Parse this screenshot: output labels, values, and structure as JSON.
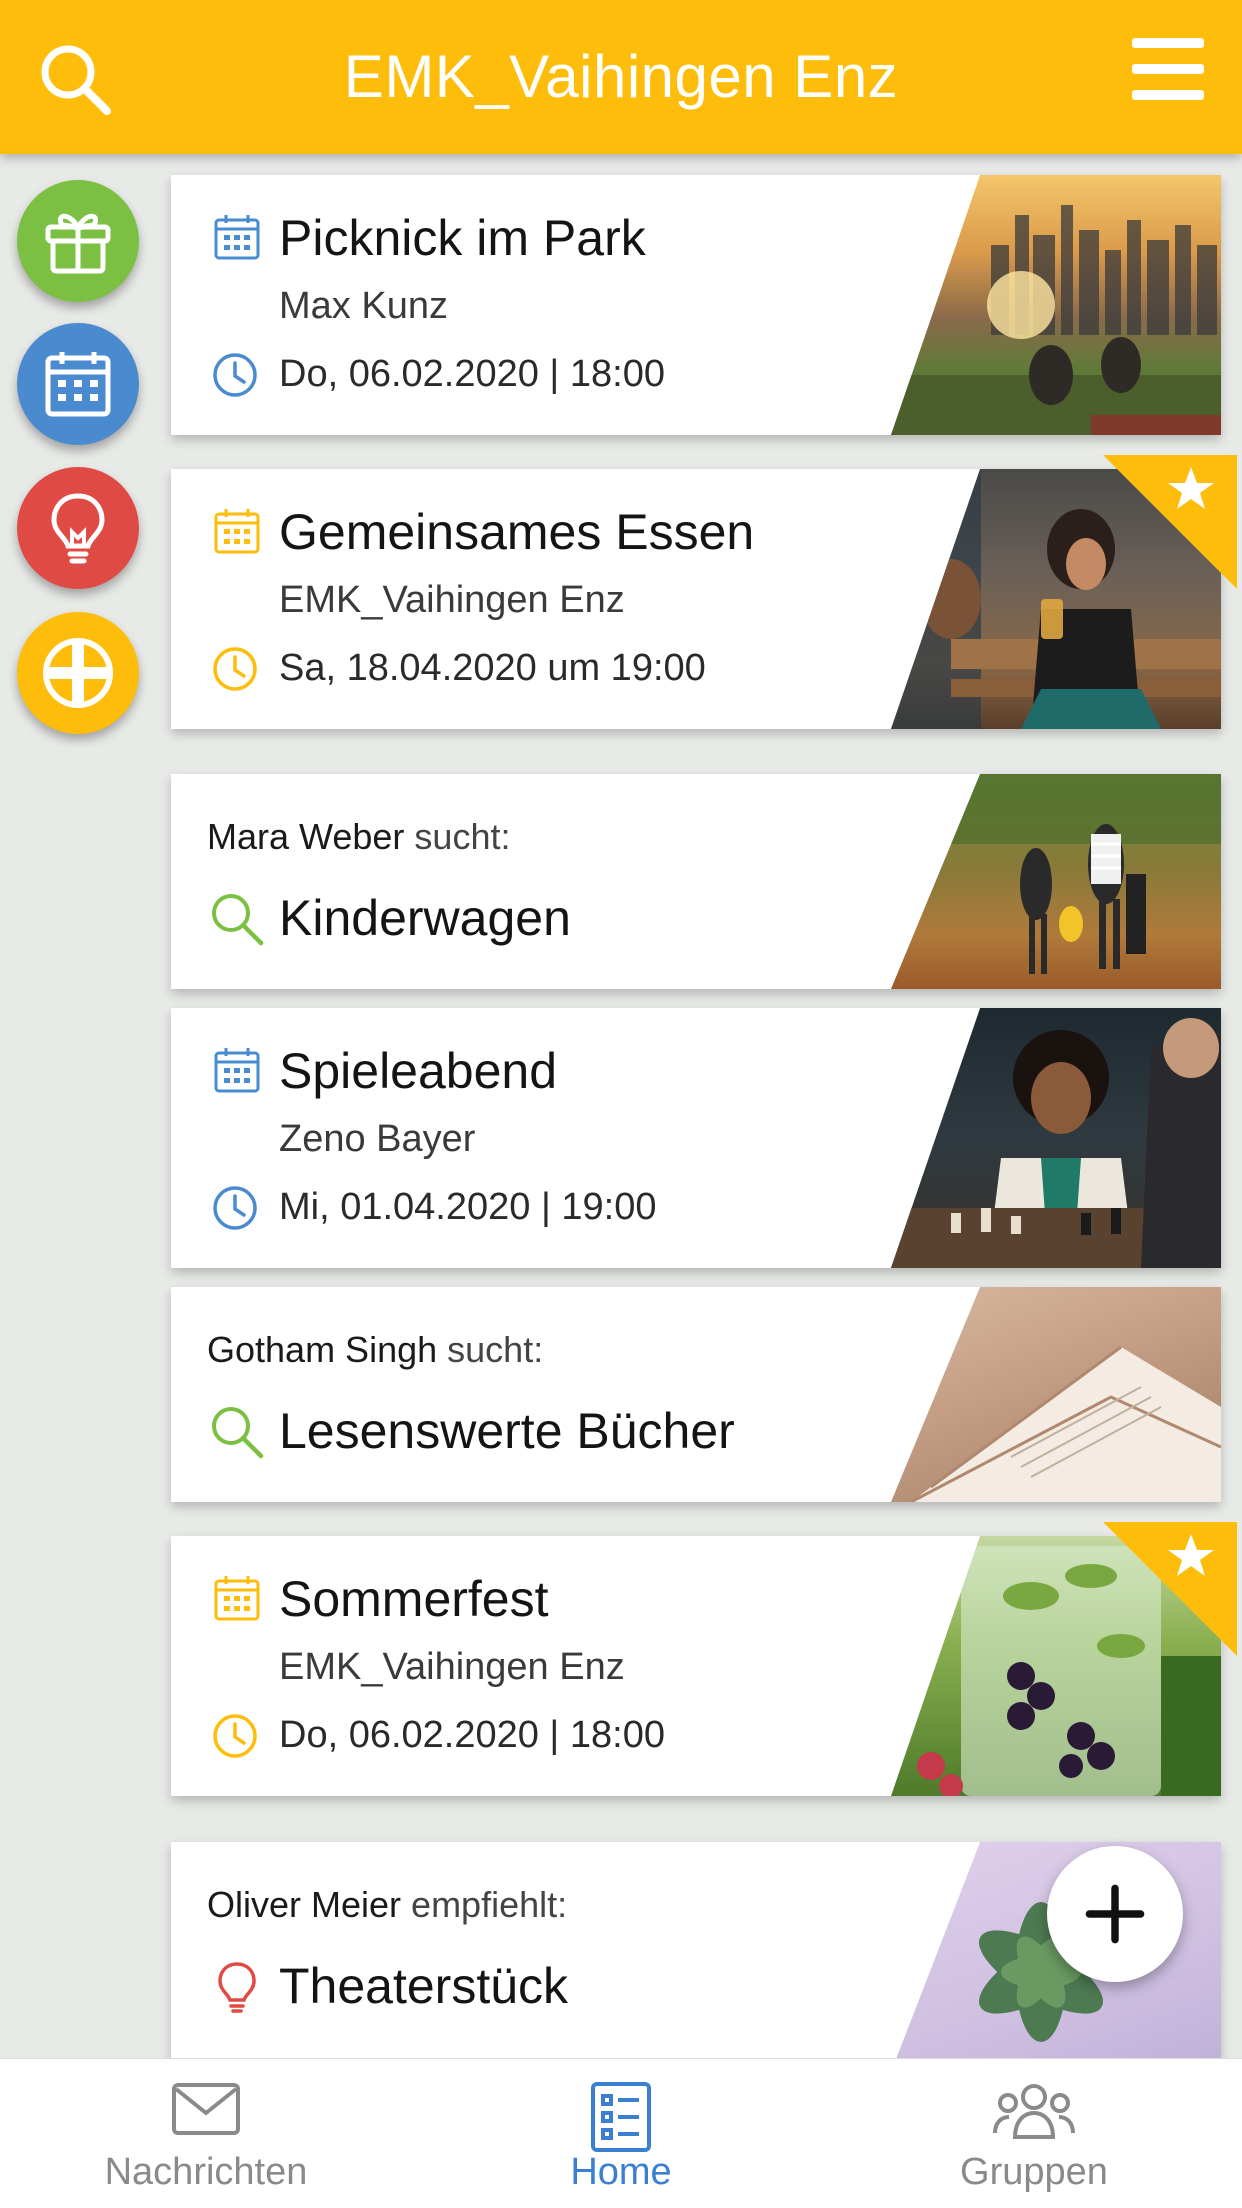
{
  "header": {
    "title": "EMK_Vaihingen Enz"
  },
  "icons": {
    "search": "search-icon",
    "menu": "menu-icon",
    "gift": "gift-icon",
    "calendar": "calendar-icon",
    "idea": "lightbulb-icon",
    "church": "cross-icon"
  },
  "colors": {
    "brand": "#fdbd0a",
    "green": "#7bc043",
    "blue": "#4a8bd0",
    "red": "#e04a44",
    "yellow": "#fdbd0a",
    "nav_active": "#3b7fd0",
    "nav_inactive": "#8a8a8a"
  },
  "cards": [
    {
      "type": "event",
      "title": "Picknick im Park",
      "subtitle": "Max Kunz",
      "datetime": "Do, 06.02.2020 | 18:00",
      "accent": "blue",
      "featured": false
    },
    {
      "type": "event",
      "title": "Gemeinsames Essen",
      "subtitle": "EMK_Vaihingen Enz",
      "datetime": "Sa, 18.04.2020 um 19:00",
      "accent": "yellow",
      "featured": true
    },
    {
      "type": "search",
      "person": "Mara Weber",
      "verb": "sucht:",
      "title": "Kinderwagen"
    },
    {
      "type": "event",
      "title": "Spieleabend",
      "subtitle": "Zeno Bayer",
      "datetime": "Mi, 01.04.2020 | 19:00",
      "accent": "blue",
      "featured": false
    },
    {
      "type": "search",
      "person": "Gotham Singh",
      "verb": "sucht:",
      "title": "Lesenswerte Bücher"
    },
    {
      "type": "event",
      "title": "Sommerfest",
      "subtitle": "EMK_Vaihingen Enz",
      "datetime": "Do, 06.02.2020 | 18:00",
      "accent": "yellow",
      "featured": true
    },
    {
      "type": "recommend",
      "person": "Oliver Meier",
      "verb": "empfiehlt:",
      "title": "Theaterstück"
    }
  ],
  "nav": [
    {
      "label": "Nachrichten",
      "icon": "mail-icon",
      "active": false
    },
    {
      "label": "Home",
      "icon": "list-icon",
      "active": true
    },
    {
      "label": "Gruppen",
      "icon": "group-icon",
      "active": false
    }
  ]
}
